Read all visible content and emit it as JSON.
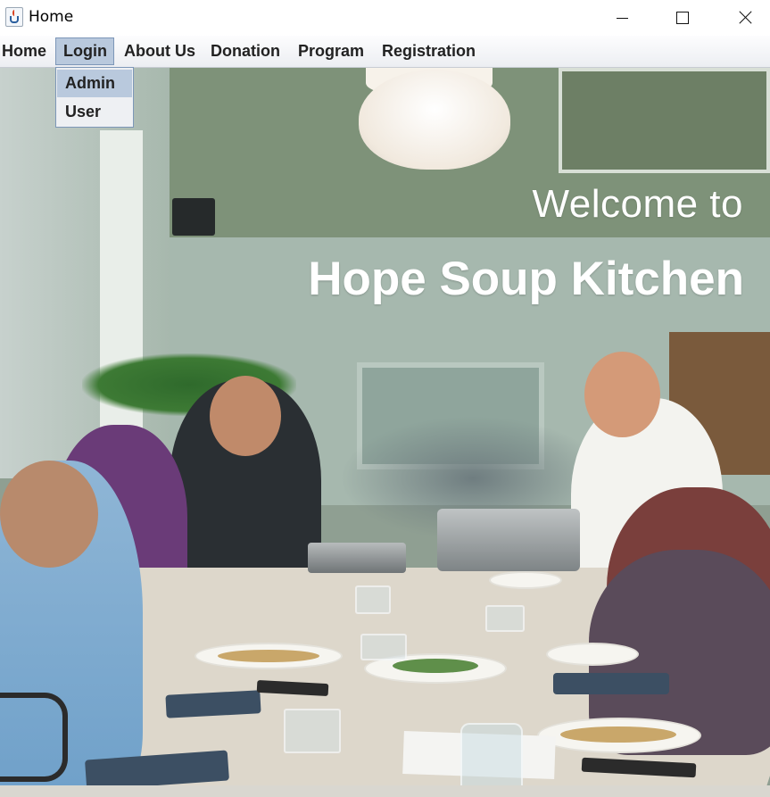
{
  "window": {
    "title": "Home",
    "icon": "java-cup-icon"
  },
  "menubar": {
    "items": [
      "Home",
      "Login",
      "About Us",
      "Donation",
      "Program",
      "Registration"
    ],
    "active_index": 1
  },
  "login_dropdown": {
    "items": [
      "Admin",
      "User"
    ],
    "highlighted_index": 0
  },
  "hero": {
    "welcome_text": "Welcome to",
    "name": "Hope Soup Kitchen",
    "text_color": "#ffffff"
  },
  "colors": {
    "menu_highlight": "#b9c9dd",
    "menu_border": "#7d97b8"
  }
}
